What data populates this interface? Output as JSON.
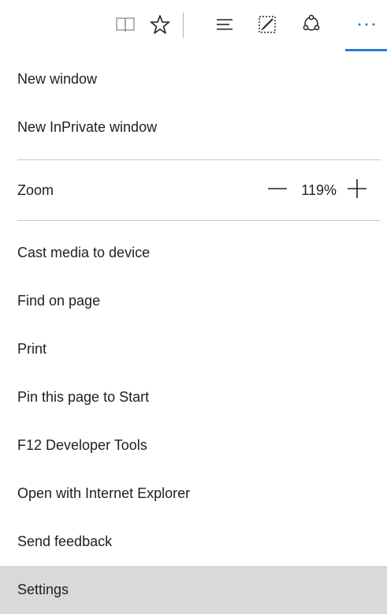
{
  "toolbar": {
    "buttons": [
      {
        "name": "reading-view",
        "icon": "book-icon"
      },
      {
        "name": "favorites",
        "icon": "star-icon"
      },
      {
        "name": "hub",
        "icon": "hub-lines-icon"
      },
      {
        "name": "web-note",
        "icon": "pen-note-icon"
      },
      {
        "name": "share",
        "icon": "share-icon"
      },
      {
        "name": "more",
        "icon": "ellipsis-icon"
      }
    ],
    "accent_color": "#2b7bd6"
  },
  "menu": {
    "group1": [
      {
        "label": "New window"
      },
      {
        "label": "New InPrivate window"
      }
    ],
    "zoom": {
      "label": "Zoom",
      "value": "119%",
      "minus_icon": "minus-icon",
      "plus_icon": "plus-icon"
    },
    "group2": [
      {
        "label": "Cast media to device"
      },
      {
        "label": "Find on page"
      },
      {
        "label": "Print"
      },
      {
        "label": "Pin this page to Start"
      },
      {
        "label": "F12 Developer Tools"
      },
      {
        "label": "Open with Internet Explorer"
      },
      {
        "label": "Send feedback"
      },
      {
        "label": "Settings",
        "selected": true
      }
    ],
    "selected_bg": "#d9d9d9"
  }
}
